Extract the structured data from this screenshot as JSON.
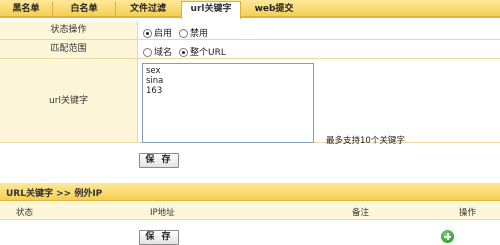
{
  "tabs": [
    {
      "label": "黑名单",
      "active": false
    },
    {
      "label": "白名单",
      "active": false
    },
    {
      "label": "文件过滤",
      "active": false
    },
    {
      "label": "url关键字",
      "active": true
    },
    {
      "label": "web提交",
      "active": false
    }
  ],
  "form": {
    "status": {
      "label": "状态操作",
      "options": [
        {
          "label": "启用",
          "checked": true
        },
        {
          "label": "禁用",
          "checked": false
        }
      ]
    },
    "match_scope": {
      "label": "匹配范围",
      "options": [
        {
          "label": "域名",
          "checked": false
        },
        {
          "label": "整个URL",
          "checked": true
        }
      ]
    },
    "keywords": {
      "label": "url关键字",
      "lines": [
        "sex",
        "sina",
        "163"
      ],
      "hint": "最多支持10个关键字"
    },
    "save_label": "保 存"
  },
  "exceptions": {
    "title": "URL关键字 >> 例外IP",
    "columns": [
      "状态",
      "IP地址",
      "备注",
      "操作"
    ],
    "save_label": "保 存"
  },
  "colors": {
    "tab_bar": "#f5cf55",
    "label_bg": "#fdf6d8",
    "border": "#ead9a4",
    "add_icon": "#1e8a1e"
  }
}
